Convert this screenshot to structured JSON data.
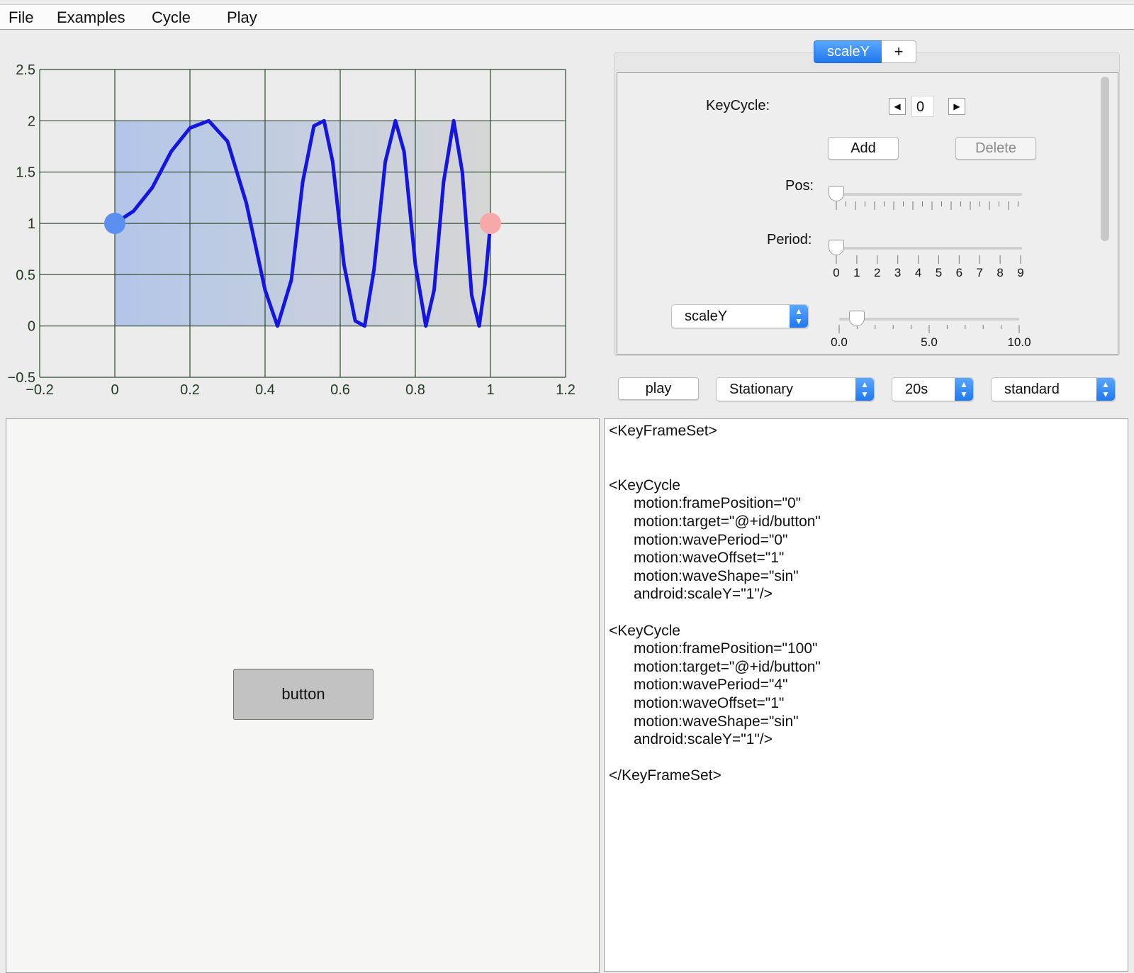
{
  "menu": {
    "items": [
      "File",
      "Examples",
      "Cycle",
      "Play"
    ]
  },
  "chart_data": {
    "type": "line",
    "xlim": [
      -0.2,
      1.2
    ],
    "ylim": [
      -0.5,
      2.5
    ],
    "x_ticks": [
      "−0.2",
      "0",
      "0.2",
      "0.4",
      "0.6",
      "0.8",
      "1",
      "1.2"
    ],
    "y_ticks": [
      "−0.5",
      "0",
      "0.5",
      "1",
      "1.5",
      "2",
      "2.5"
    ],
    "grid": true,
    "series": [
      {
        "x": [
          0,
          0.05,
          0.1,
          0.15,
          0.2,
          0.25,
          0.3,
          0.35,
          0.4,
          0.433,
          0.47,
          0.5,
          0.53,
          0.557,
          0.58,
          0.61,
          0.64,
          0.665,
          0.69,
          0.72,
          0.747,
          0.77,
          0.8,
          0.828,
          0.85,
          0.875,
          0.902,
          0.925,
          0.95,
          0.97,
          0.985,
          1.0
        ],
        "y": [
          1.0,
          1.12,
          1.35,
          1.7,
          1.93,
          2.0,
          1.8,
          1.2,
          0.35,
          0.0,
          0.45,
          1.4,
          1.95,
          2.0,
          1.6,
          0.6,
          0.05,
          0.0,
          0.55,
          1.6,
          2.0,
          1.7,
          0.6,
          0.0,
          0.35,
          1.4,
          2.0,
          1.5,
          0.3,
          0.0,
          0.4,
          1.0
        ],
        "color": "#1515e0"
      }
    ],
    "shaded_region": {
      "x": [
        0,
        1
      ],
      "y": [
        0,
        2
      ]
    },
    "points": [
      {
        "x": 0,
        "y": 1,
        "color": "#5b8ff0"
      },
      {
        "x": 1,
        "y": 1,
        "color": "#f7a9a9"
      }
    ]
  },
  "tabs": {
    "active": "scaleY",
    "add": "+"
  },
  "keycycle": {
    "label": "KeyCycle:",
    "index": "0",
    "prev_icon": "left-arrow-icon",
    "next_icon": "right-arrow-icon",
    "add_label": "Add",
    "delete_label": "Delete"
  },
  "pos": {
    "label": "Pos:",
    "value": 0
  },
  "period": {
    "label": "Period:",
    "value": 0,
    "tick_labels": [
      "0",
      "1",
      "2",
      "3",
      "4",
      "5",
      "6",
      "7",
      "8",
      "9"
    ]
  },
  "attribute": {
    "selected": "scaleY",
    "value": 1.0,
    "tick_labels": [
      "0.0",
      "5.0",
      "10.0"
    ]
  },
  "controls": {
    "play_label": "play",
    "mode": "Stationary",
    "duration": "20s",
    "easing": "standard"
  },
  "preview": {
    "button_label": "button"
  },
  "code": {
    "lines": [
      "<KeyFrameSet>",
      "",
      "",
      "<KeyCycle",
      "      motion:framePosition=\"0\"",
      "      motion:target=\"@+id/button\"",
      "      motion:wavePeriod=\"0\"",
      "      motion:waveOffset=\"1\"",
      "      motion:waveShape=\"sin\"",
      "      android:scaleY=\"1\"/>",
      "",
      "<KeyCycle",
      "      motion:framePosition=\"100\"",
      "      motion:target=\"@+id/button\"",
      "      motion:wavePeriod=\"4\"",
      "      motion:waveOffset=\"1\"",
      "      motion:waveShape=\"sin\"",
      "      android:scaleY=\"1\"/>",
      "",
      "</KeyFrameSet>"
    ]
  },
  "colors": {
    "accent": "#1f78f0",
    "curve": "#1515e0",
    "grid": "#2f4a2f",
    "shade": "#a9bfe8"
  }
}
